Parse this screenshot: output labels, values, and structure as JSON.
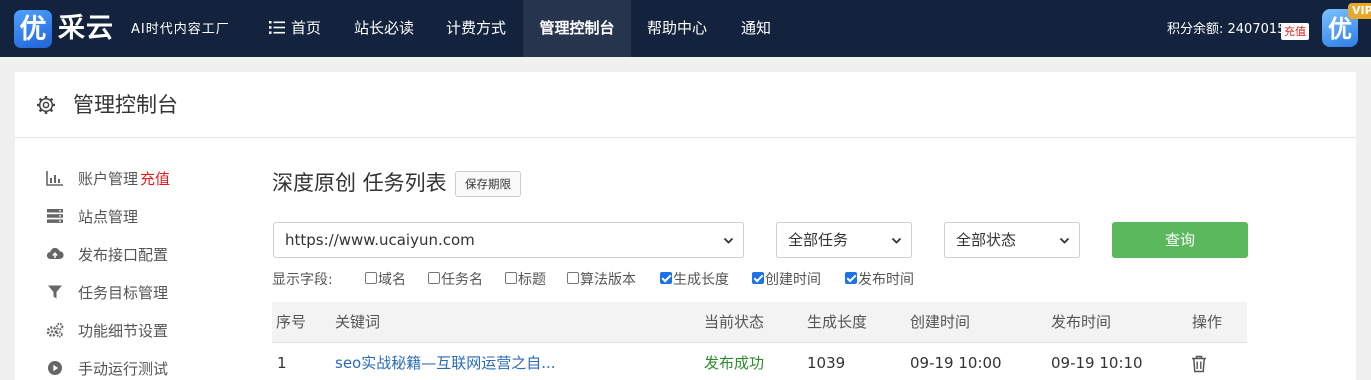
{
  "brand": {
    "logo_glyph": "优",
    "name": "采云",
    "tagline": "AI时代内容工厂"
  },
  "nav": [
    {
      "label": "首页",
      "icon": "menu-icon"
    },
    {
      "label": "站长必读"
    },
    {
      "label": "计费方式"
    },
    {
      "label": "管理控制台",
      "active": true
    },
    {
      "label": "帮助中心"
    },
    {
      "label": "通知"
    }
  ],
  "account": {
    "credits_text": "积分余额: 2407015",
    "recharge_label": "充值",
    "vip_badge": "VIP",
    "avatar_glyph": "优"
  },
  "panel": {
    "title": "管理控制台",
    "icon": "gear-icon"
  },
  "sidebar": [
    {
      "label": "账户管理",
      "badge": "充值",
      "icon": "bar-chart-icon"
    },
    {
      "label": "站点管理",
      "icon": "server-icon"
    },
    {
      "label": "发布接口配置",
      "icon": "cloud-upload-icon"
    },
    {
      "label": "任务目标管理",
      "icon": "filter-icon"
    },
    {
      "label": "功能细节设置",
      "icon": "gears-icon"
    },
    {
      "label": "手动运行测试",
      "icon": "play-circle-icon"
    }
  ],
  "content": {
    "title": "深度原创 任务列表",
    "retention_button": "保存期限",
    "filters": {
      "site_select": "https://www.ucaiyun.com",
      "task_select": "全部任务",
      "status_select": "全部状态",
      "query_button": "查询"
    },
    "fields": {
      "label": "显示字段:",
      "options": [
        {
          "label": "域名",
          "checked": false
        },
        {
          "label": "任务名",
          "checked": false
        },
        {
          "label": "标题",
          "checked": false
        },
        {
          "label": "算法版本",
          "checked": false
        },
        {
          "label": "生成长度",
          "checked": true
        },
        {
          "label": "创建时间",
          "checked": true
        },
        {
          "label": "发布时间",
          "checked": true
        }
      ]
    },
    "table": {
      "columns": [
        "序号",
        "关键词",
        "当前状态",
        "生成长度",
        "创建时间",
        "发布时间",
        "操作"
      ],
      "rows": [
        {
          "index": "1",
          "keyword": "seo实战秘籍—互联网运营之自...",
          "status": "发布成功",
          "length": "1039",
          "created": "09-19 10:00",
          "published": "09-19 10:10",
          "action_icon": "trash-icon"
        }
      ]
    }
  },
  "colors": {
    "nav_bg": "#13233d",
    "nav_active": "#27344d",
    "query_green": "#5cb85c",
    "link_blue": "#2a6ab8",
    "success_green": "#2e8b2e",
    "recharge_red": "#e02020",
    "vip_gold": "#e8a72a"
  }
}
